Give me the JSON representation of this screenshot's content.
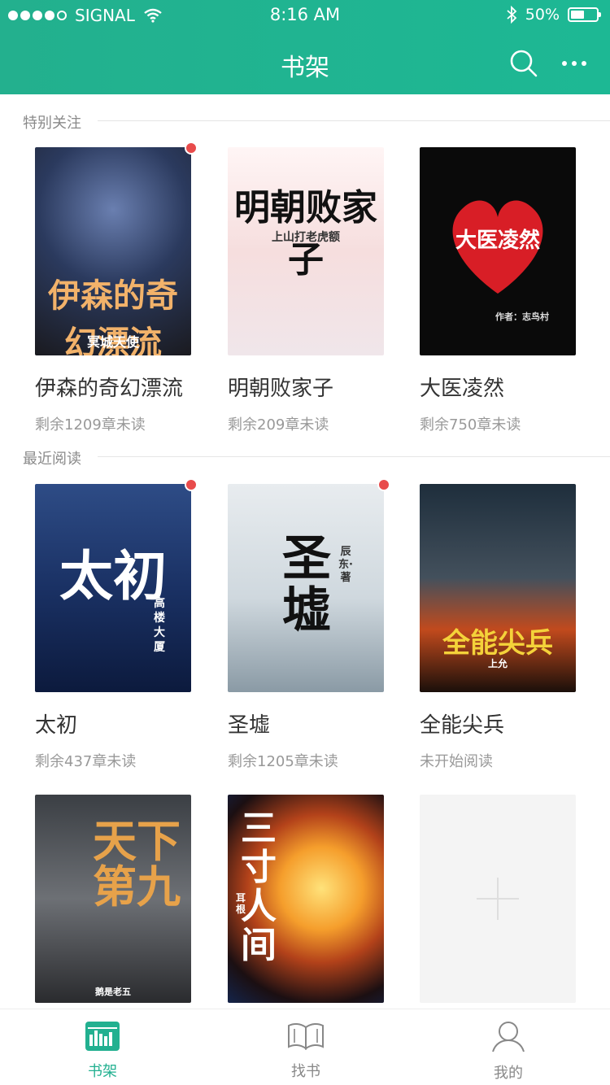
{
  "status": {
    "carrier": "SIGNAL",
    "time": "8:16 AM",
    "battery": "50%"
  },
  "header": {
    "title": "书架"
  },
  "sections": {
    "special": {
      "label": "特别关注"
    },
    "recent": {
      "label": "最近阅读"
    }
  },
  "special_books": [
    {
      "title": "伊森的奇幻漂流",
      "sub": "剩余1209章未读",
      "cover_text": "伊森的奇幻漂流",
      "cover_author": "冥城天使",
      "has_update": true
    },
    {
      "title": "明朝败家子",
      "sub": "剩余209章未读",
      "cover_text": "明朝败家子",
      "cover_author": "上山打老虎额",
      "has_update": false
    },
    {
      "title": "大医凌然",
      "sub": "剩余750章未读",
      "cover_text": "大医凌然",
      "cover_author": "作者：志鸟村",
      "has_update": false
    }
  ],
  "recent_books": [
    {
      "title": "太初",
      "sub": "剩余437章未读",
      "cover_text": "太初",
      "cover_author": "高楼大厦",
      "has_update": true
    },
    {
      "title": "圣墟",
      "sub": "剩余1205章未读",
      "cover_text": "圣墟",
      "cover_author": "辰东·著",
      "has_update": true
    },
    {
      "title": "全能尖兵",
      "sub": "未开始阅读",
      "cover_text": "全能尖兵",
      "cover_author": "上允",
      "has_update": false
    },
    {
      "cover_text": "天下第九",
      "cover_author": "鹅是老五",
      "has_update": false
    },
    {
      "cover_text": "三寸人间",
      "cover_author": "耳根",
      "has_update": false
    }
  ],
  "tabs": [
    {
      "label": "书架",
      "icon": "bookshelf-icon"
    },
    {
      "label": "找书",
      "icon": "open-book-icon"
    },
    {
      "label": "我的",
      "icon": "user-icon"
    }
  ],
  "colors": {
    "accent": "#22b090",
    "badge": "#e84b4b"
  }
}
